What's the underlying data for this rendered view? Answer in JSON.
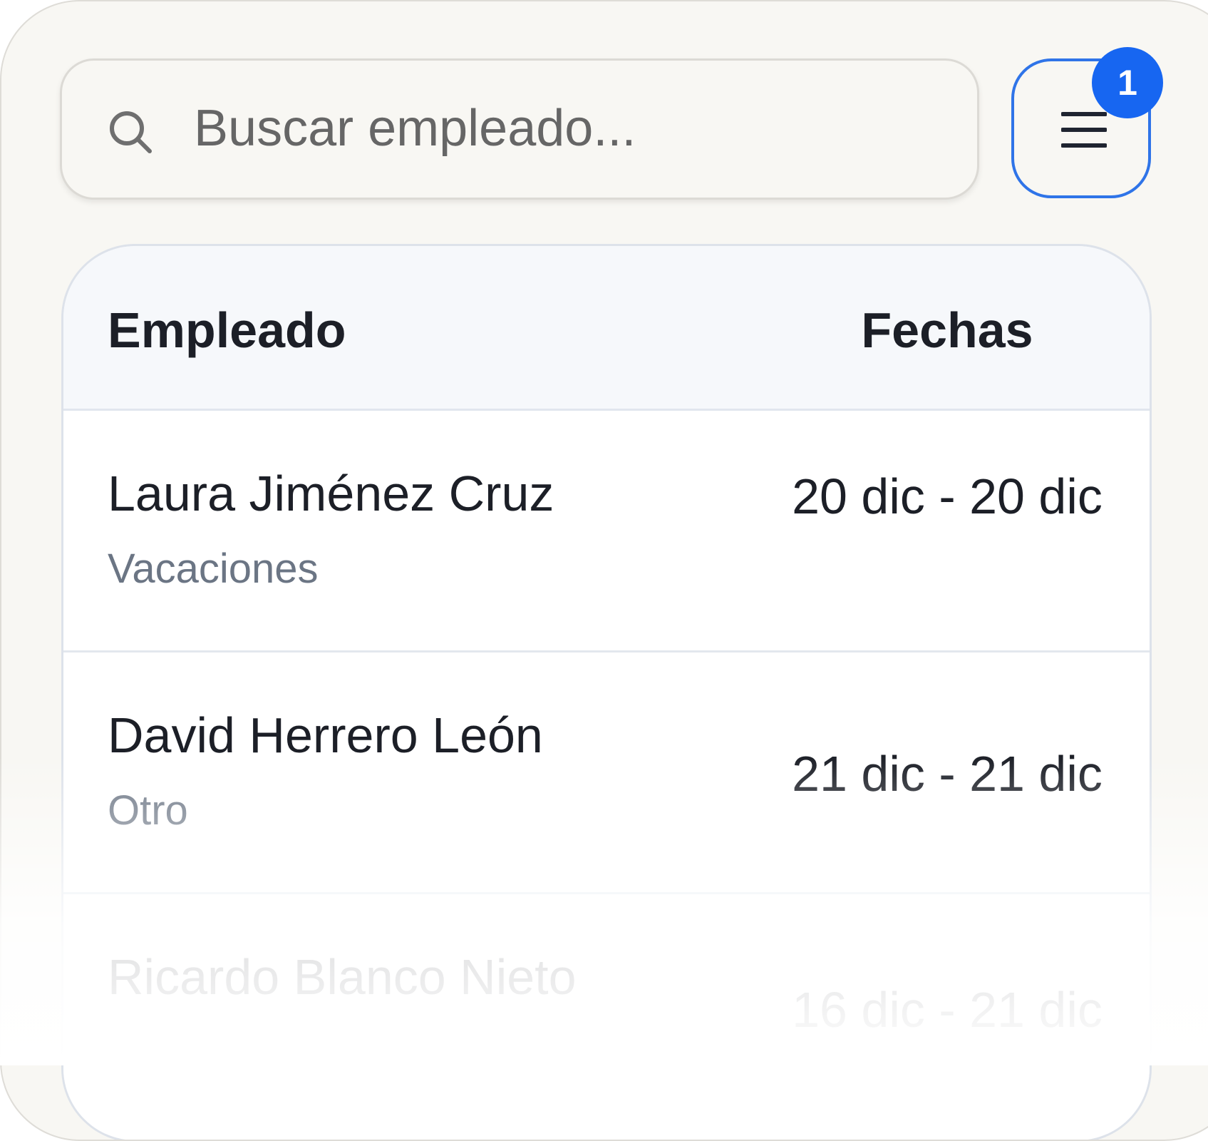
{
  "search": {
    "placeholder": "Buscar empleado...",
    "value": ""
  },
  "filter_button": {
    "badge_count": "1",
    "icon": "menu-icon"
  },
  "table": {
    "headers": {
      "employee": "Empleado",
      "dates": "Fechas"
    },
    "rows": [
      {
        "name": "Laura Jiménez Cruz",
        "type": "Vacaciones",
        "dates": "20 dic - 20 dic"
      },
      {
        "name": "David Herrero León",
        "type": "Otro",
        "dates": "21 dic - 21 dic"
      },
      {
        "name": "Ricardo Blanco Nieto",
        "type": "",
        "dates": "16 dic - 21 dic"
      }
    ]
  },
  "colors": {
    "accent": "#1766f1",
    "focus_border": "#2f74e8",
    "background": "#f8f7f3",
    "text_primary": "#1c1f27",
    "text_secondary": "#6b7584"
  }
}
